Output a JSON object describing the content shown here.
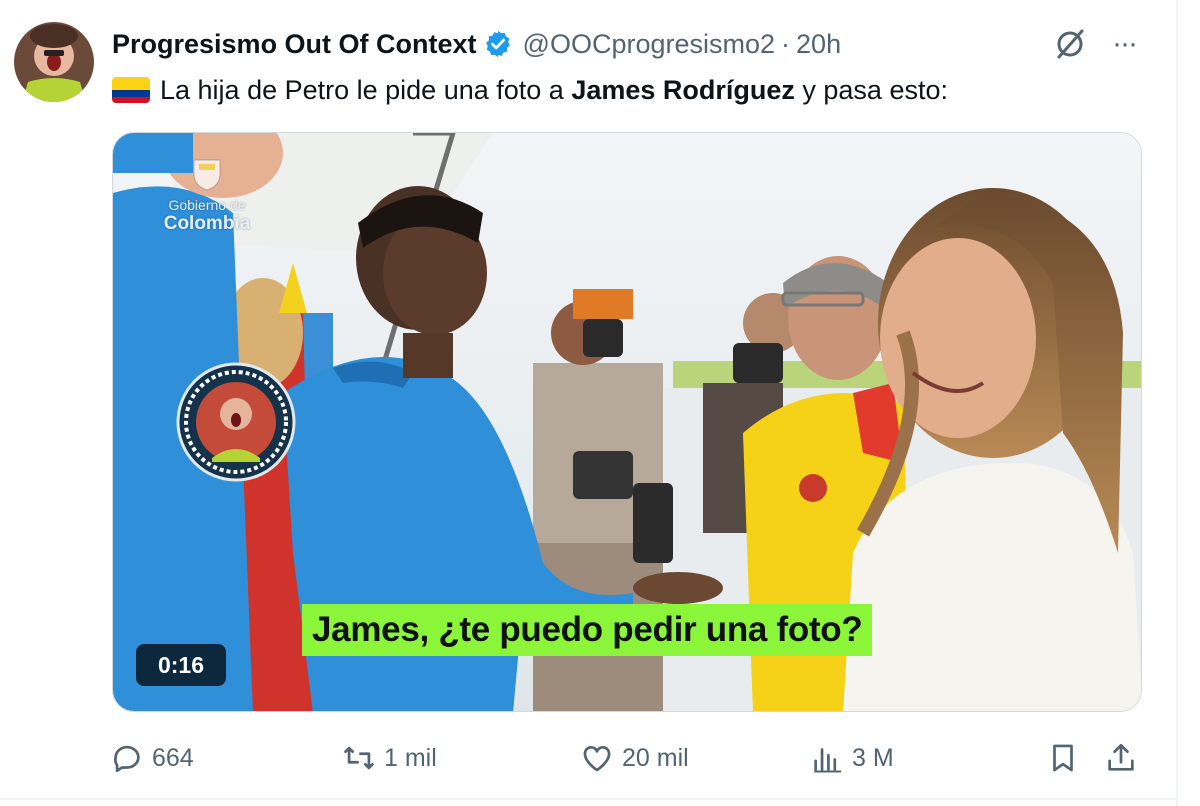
{
  "tweet": {
    "author_name": "Progresismo Out Of Context",
    "handle": "@OOCprogresismo2",
    "separator": "·",
    "time": "20h",
    "more_label": "···",
    "text_prefix": "La hija de Petro le pide una foto a ",
    "text_bold": "James Rodríguez",
    "text_suffix": " y pasa esto:"
  },
  "media": {
    "caption": "James, ¿te puedo pedir una foto?",
    "duration": "0:16",
    "logo_line1": "Gobierno de",
    "logo_line2": "Colombia"
  },
  "actions": {
    "replies": "664",
    "retweets": "1 mil",
    "likes": "20 mil",
    "views": "3 M"
  },
  "colors": {
    "verified": "#1d9bf0",
    "muted_text": "#536471",
    "caption_bg": "#8bf53a",
    "jersey_blue": "#2f8fd8",
    "jersey_yellow": "#f5d218"
  },
  "icons": [
    "verified-badge-icon",
    "grok-icon",
    "more-icon",
    "reply-icon",
    "retweet-icon",
    "like-icon",
    "views-icon",
    "bookmark-icon",
    "share-icon",
    "colombia-flag-icon"
  ]
}
